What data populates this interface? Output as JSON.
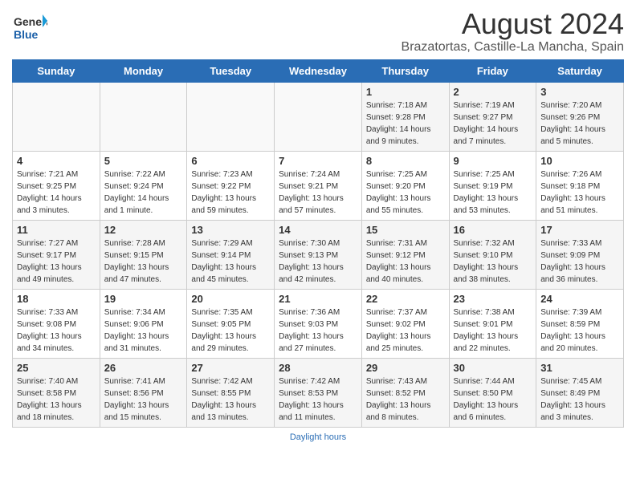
{
  "logo": {
    "general": "General",
    "blue": "Blue",
    "icon": "▶"
  },
  "title": "August 2024",
  "location": "Brazatortas, Castille-La Mancha, Spain",
  "days_of_week": [
    "Sunday",
    "Monday",
    "Tuesday",
    "Wednesday",
    "Thursday",
    "Friday",
    "Saturday"
  ],
  "footer_text": "Daylight hours",
  "weeks": [
    [
      {
        "day": "",
        "sunrise": "",
        "sunset": "",
        "daylight": ""
      },
      {
        "day": "",
        "sunrise": "",
        "sunset": "",
        "daylight": ""
      },
      {
        "day": "",
        "sunrise": "",
        "sunset": "",
        "daylight": ""
      },
      {
        "day": "",
        "sunrise": "",
        "sunset": "",
        "daylight": ""
      },
      {
        "day": "1",
        "sunrise": "Sunrise: 7:18 AM",
        "sunset": "Sunset: 9:28 PM",
        "daylight": "Daylight: 14 hours and 9 minutes."
      },
      {
        "day": "2",
        "sunrise": "Sunrise: 7:19 AM",
        "sunset": "Sunset: 9:27 PM",
        "daylight": "Daylight: 14 hours and 7 minutes."
      },
      {
        "day": "3",
        "sunrise": "Sunrise: 7:20 AM",
        "sunset": "Sunset: 9:26 PM",
        "daylight": "Daylight: 14 hours and 5 minutes."
      }
    ],
    [
      {
        "day": "4",
        "sunrise": "Sunrise: 7:21 AM",
        "sunset": "Sunset: 9:25 PM",
        "daylight": "Daylight: 14 hours and 3 minutes."
      },
      {
        "day": "5",
        "sunrise": "Sunrise: 7:22 AM",
        "sunset": "Sunset: 9:24 PM",
        "daylight": "Daylight: 14 hours and 1 minute."
      },
      {
        "day": "6",
        "sunrise": "Sunrise: 7:23 AM",
        "sunset": "Sunset: 9:22 PM",
        "daylight": "Daylight: 13 hours and 59 minutes."
      },
      {
        "day": "7",
        "sunrise": "Sunrise: 7:24 AM",
        "sunset": "Sunset: 9:21 PM",
        "daylight": "Daylight: 13 hours and 57 minutes."
      },
      {
        "day": "8",
        "sunrise": "Sunrise: 7:25 AM",
        "sunset": "Sunset: 9:20 PM",
        "daylight": "Daylight: 13 hours and 55 minutes."
      },
      {
        "day": "9",
        "sunrise": "Sunrise: 7:25 AM",
        "sunset": "Sunset: 9:19 PM",
        "daylight": "Daylight: 13 hours and 53 minutes."
      },
      {
        "day": "10",
        "sunrise": "Sunrise: 7:26 AM",
        "sunset": "Sunset: 9:18 PM",
        "daylight": "Daylight: 13 hours and 51 minutes."
      }
    ],
    [
      {
        "day": "11",
        "sunrise": "Sunrise: 7:27 AM",
        "sunset": "Sunset: 9:17 PM",
        "daylight": "Daylight: 13 hours and 49 minutes."
      },
      {
        "day": "12",
        "sunrise": "Sunrise: 7:28 AM",
        "sunset": "Sunset: 9:15 PM",
        "daylight": "Daylight: 13 hours and 47 minutes."
      },
      {
        "day": "13",
        "sunrise": "Sunrise: 7:29 AM",
        "sunset": "Sunset: 9:14 PM",
        "daylight": "Daylight: 13 hours and 45 minutes."
      },
      {
        "day": "14",
        "sunrise": "Sunrise: 7:30 AM",
        "sunset": "Sunset: 9:13 PM",
        "daylight": "Daylight: 13 hours and 42 minutes."
      },
      {
        "day": "15",
        "sunrise": "Sunrise: 7:31 AM",
        "sunset": "Sunset: 9:12 PM",
        "daylight": "Daylight: 13 hours and 40 minutes."
      },
      {
        "day": "16",
        "sunrise": "Sunrise: 7:32 AM",
        "sunset": "Sunset: 9:10 PM",
        "daylight": "Daylight: 13 hours and 38 minutes."
      },
      {
        "day": "17",
        "sunrise": "Sunrise: 7:33 AM",
        "sunset": "Sunset: 9:09 PM",
        "daylight": "Daylight: 13 hours and 36 minutes."
      }
    ],
    [
      {
        "day": "18",
        "sunrise": "Sunrise: 7:33 AM",
        "sunset": "Sunset: 9:08 PM",
        "daylight": "Daylight: 13 hours and 34 minutes."
      },
      {
        "day": "19",
        "sunrise": "Sunrise: 7:34 AM",
        "sunset": "Sunset: 9:06 PM",
        "daylight": "Daylight: 13 hours and 31 minutes."
      },
      {
        "day": "20",
        "sunrise": "Sunrise: 7:35 AM",
        "sunset": "Sunset: 9:05 PM",
        "daylight": "Daylight: 13 hours and 29 minutes."
      },
      {
        "day": "21",
        "sunrise": "Sunrise: 7:36 AM",
        "sunset": "Sunset: 9:03 PM",
        "daylight": "Daylight: 13 hours and 27 minutes."
      },
      {
        "day": "22",
        "sunrise": "Sunrise: 7:37 AM",
        "sunset": "Sunset: 9:02 PM",
        "daylight": "Daylight: 13 hours and 25 minutes."
      },
      {
        "day": "23",
        "sunrise": "Sunrise: 7:38 AM",
        "sunset": "Sunset: 9:01 PM",
        "daylight": "Daylight: 13 hours and 22 minutes."
      },
      {
        "day": "24",
        "sunrise": "Sunrise: 7:39 AM",
        "sunset": "Sunset: 8:59 PM",
        "daylight": "Daylight: 13 hours and 20 minutes."
      }
    ],
    [
      {
        "day": "25",
        "sunrise": "Sunrise: 7:40 AM",
        "sunset": "Sunset: 8:58 PM",
        "daylight": "Daylight: 13 hours and 18 minutes."
      },
      {
        "day": "26",
        "sunrise": "Sunrise: 7:41 AM",
        "sunset": "Sunset: 8:56 PM",
        "daylight": "Daylight: 13 hours and 15 minutes."
      },
      {
        "day": "27",
        "sunrise": "Sunrise: 7:42 AM",
        "sunset": "Sunset: 8:55 PM",
        "daylight": "Daylight: 13 hours and 13 minutes."
      },
      {
        "day": "28",
        "sunrise": "Sunrise: 7:42 AM",
        "sunset": "Sunset: 8:53 PM",
        "daylight": "Daylight: 13 hours and 11 minutes."
      },
      {
        "day": "29",
        "sunrise": "Sunrise: 7:43 AM",
        "sunset": "Sunset: 8:52 PM",
        "daylight": "Daylight: 13 hours and 8 minutes."
      },
      {
        "day": "30",
        "sunrise": "Sunrise: 7:44 AM",
        "sunset": "Sunset: 8:50 PM",
        "daylight": "Daylight: 13 hours and 6 minutes."
      },
      {
        "day": "31",
        "sunrise": "Sunrise: 7:45 AM",
        "sunset": "Sunset: 8:49 PM",
        "daylight": "Daylight: 13 hours and 3 minutes."
      }
    ]
  ]
}
